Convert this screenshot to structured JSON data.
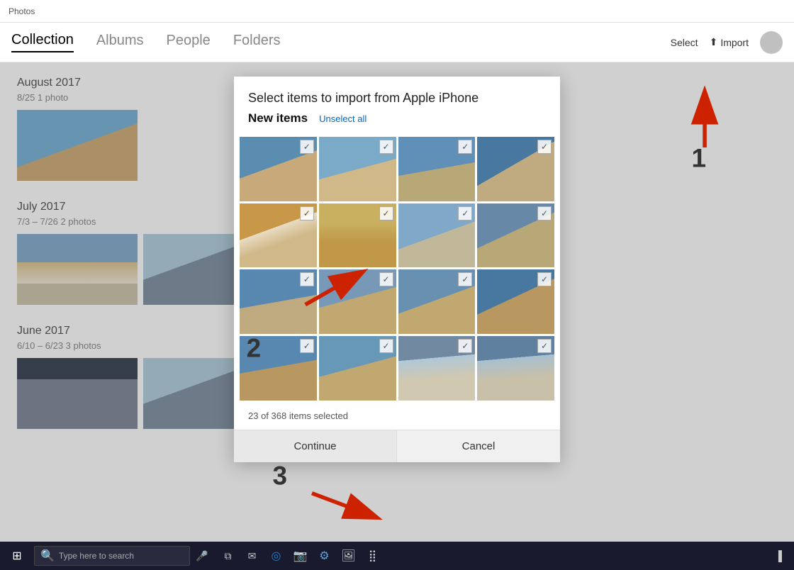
{
  "app": {
    "title": "Photos",
    "nav_items": [
      "Collection",
      "Albums",
      "People",
      "Folders"
    ],
    "active_nav": "Collection",
    "select_label": "Select",
    "import_label": "Import"
  },
  "dialog": {
    "title": "Select items to import from Apple iPhone",
    "subtitle": "New items",
    "unselect_all": "Unselect all",
    "status": "23 of 368 items selected",
    "continue_label": "Continue",
    "cancel_label": "Cancel"
  },
  "collection": {
    "groups": [
      {
        "month": "August 2017",
        "range": "8/25   1 photo",
        "thumbs": [
          "beach"
        ]
      },
      {
        "month": "July 2017",
        "range": "7/3 – 7/26   2 photos",
        "thumbs": [
          "lighthouse",
          "group"
        ]
      },
      {
        "month": "June 2017",
        "range": "6/10 – 6/23   3 photos",
        "thumbs": [
          "dark"
        ]
      }
    ]
  },
  "taskbar": {
    "search_placeholder": "Type here to search"
  },
  "annotations": {
    "one": "1",
    "two": "2",
    "three": "3"
  }
}
